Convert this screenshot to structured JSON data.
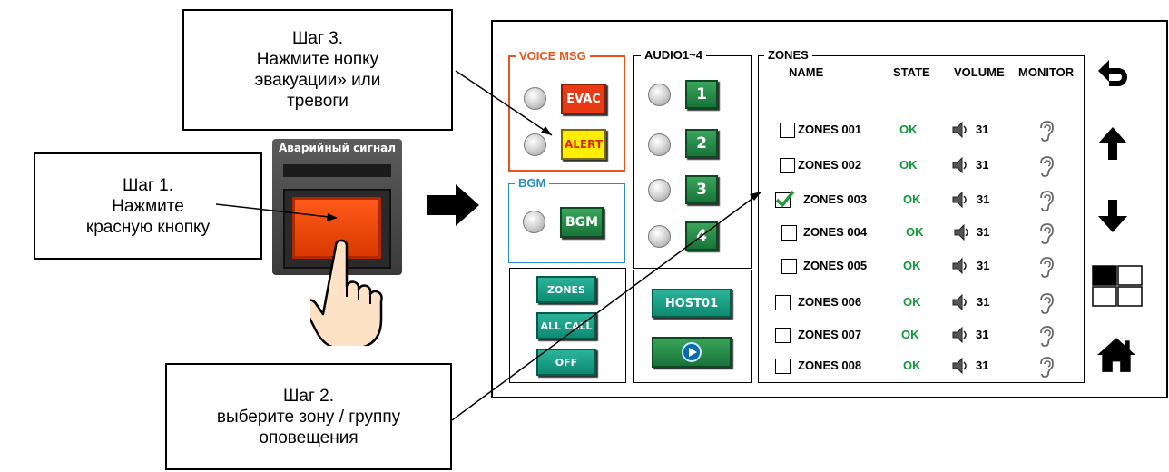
{
  "callouts": {
    "step3": [
      "Шаг 3.",
      "Нажмите нопку",
      "эвакуации» или",
      "тревоги"
    ],
    "step1": [
      "Шаг 1.",
      "Нажмите",
      "красную кнопку"
    ],
    "step2": [
      "Шаг 2.",
      "выберите зону / группу",
      "оповещения"
    ]
  },
  "device": {
    "label": "Аварийный сигнал",
    "button_color": "#ff4a10"
  },
  "panel": {
    "voice_msg": {
      "label": "VOICE MSG",
      "evac": "EVAC",
      "alert": "ALERT"
    },
    "bgm": {
      "label": "BGM",
      "button": "BGM"
    },
    "audio": {
      "label": "AUDIO1~4",
      "buttons": [
        "1",
        "2",
        "3",
        "4"
      ]
    },
    "modes": {
      "zones": "ZONES",
      "all_call": "ALL CALL",
      "off": "OFF"
    },
    "host": {
      "label": "HOST01"
    },
    "zones": {
      "label": "ZONES",
      "headers": {
        "name": "NAME",
        "state": "STATE",
        "volume": "VOLUME",
        "monitor": "MONITOR"
      },
      "rows": [
        {
          "name": "ZONES 001",
          "state": "OK",
          "volume": "31",
          "checked": false
        },
        {
          "name": "ZONES 002",
          "state": "OK",
          "volume": "31",
          "checked": false
        },
        {
          "name": "ZONES 003",
          "state": "OK",
          "volume": "31",
          "checked": true
        },
        {
          "name": "ZONES 004",
          "state": "OK",
          "volume": "31",
          "checked": false
        },
        {
          "name": "ZONES 005",
          "state": "OK",
          "volume": "31",
          "checked": false
        },
        {
          "name": "ZONES 006",
          "state": "OK",
          "volume": "31",
          "checked": false
        },
        {
          "name": "ZONES 007",
          "state": "OK",
          "volume": "31",
          "checked": false
        },
        {
          "name": "ZONES 008",
          "state": "OK",
          "volume": "31",
          "checked": false
        }
      ]
    },
    "nav_icons": [
      "back-icon",
      "arrow-up-icon",
      "arrow-down-icon",
      "layout-grid-icon",
      "home-icon"
    ]
  },
  "colors": {
    "voice_border": "#e8541c",
    "bgm_border": "#2a8dc8",
    "state_ok": "#129a3c",
    "evac": "#e83a14",
    "alert": "#ffee00",
    "green_btn": "#18743a",
    "teal_btn": "#0b8b72"
  }
}
